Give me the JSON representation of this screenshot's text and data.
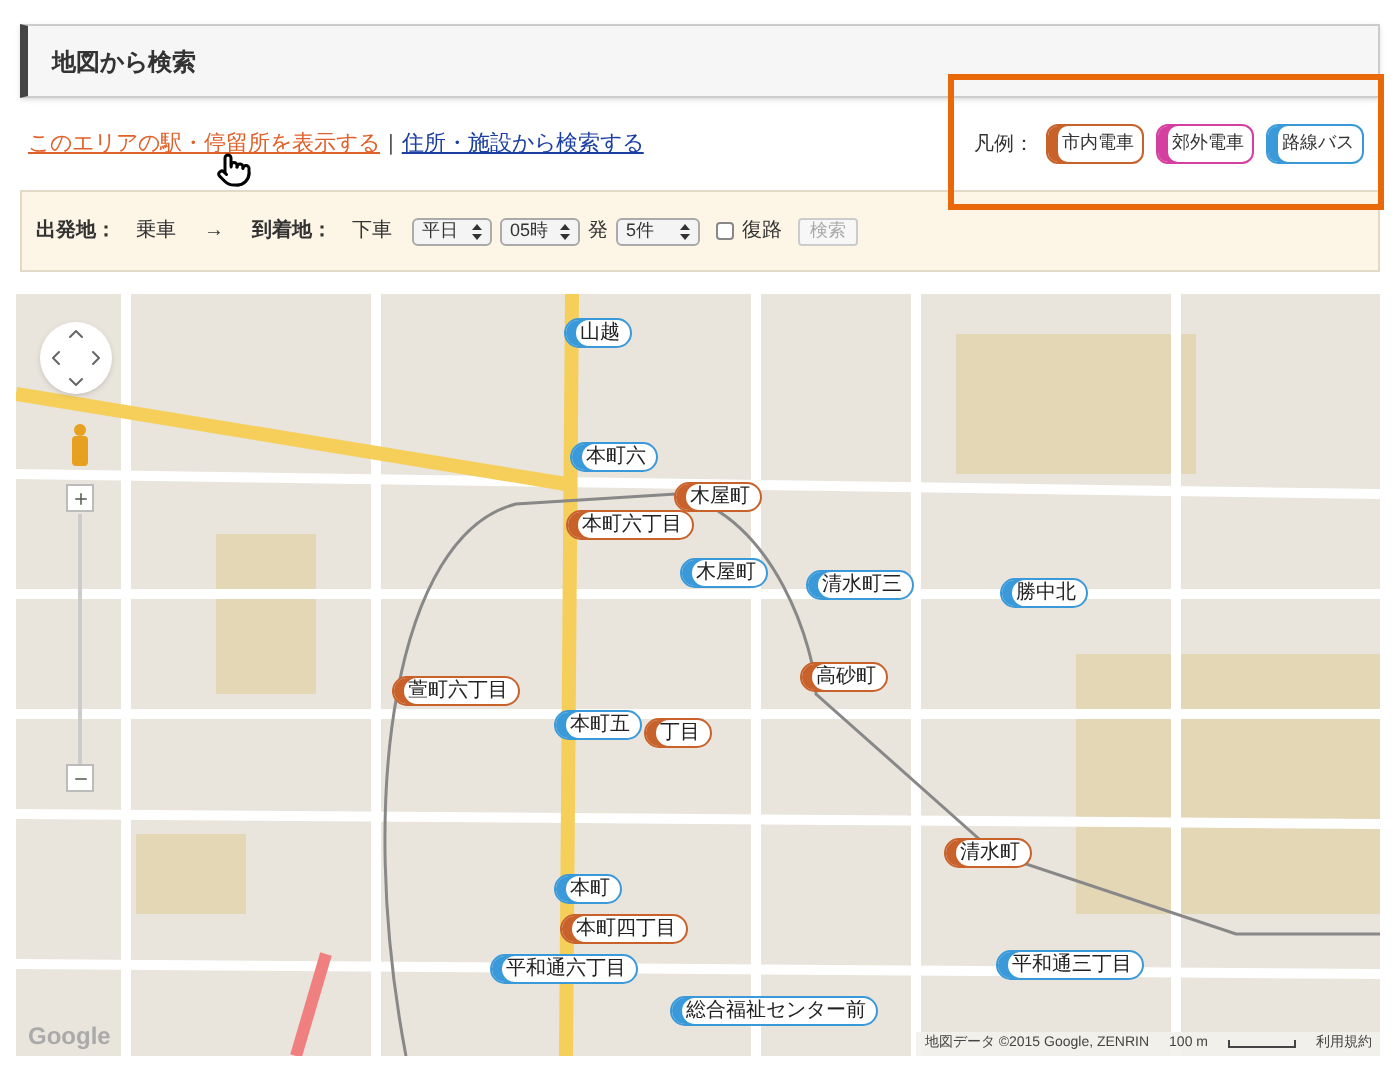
{
  "page_title": "地図から検索",
  "links": [
    {
      "text": "このエリアの駅・停留所を表示する",
      "selected": true
    },
    {
      "text": "住所・施設から検索する",
      "selected": false
    }
  ],
  "separator": "|",
  "legend": {
    "label": "凡例：",
    "items": [
      {
        "text": "市内電車",
        "color": "#c8612a"
      },
      {
        "text": "郊外電車",
        "color": "#d43fa0"
      },
      {
        "text": "路線バス",
        "color": "#3a9ad9"
      }
    ]
  },
  "search_bar": {
    "from_label": "出発地：",
    "from_value": "乗車",
    "arrow": "→",
    "to_label": "到着地：",
    "to_value": "下車",
    "day": "平日",
    "hour": "05時",
    "depart": "発",
    "count": "5件",
    "return": {
      "label": "復路",
      "checked": false
    },
    "search_button": "検索"
  },
  "map": {
    "markers": [
      {
        "kind": "bus",
        "label": "山越"
      },
      {
        "kind": "bus",
        "label": "本町六"
      },
      {
        "kind": "tram",
        "label": "木屋町"
      },
      {
        "kind": "tram",
        "label": "本町六丁目"
      },
      {
        "kind": "bus",
        "label": "木屋町"
      },
      {
        "kind": "bus",
        "label": "清水町三"
      },
      {
        "kind": "bus",
        "label": "勝中北"
      },
      {
        "kind": "tram",
        "label": "高砂町"
      },
      {
        "kind": "tram",
        "label": "萱町六丁目"
      },
      {
        "kind": "tram",
        "label": "丁目"
      },
      {
        "kind": "bus",
        "label": "本町五"
      },
      {
        "kind": "bus",
        "label": "本町"
      },
      {
        "kind": "tram",
        "label": "本町四丁目"
      },
      {
        "kind": "bus",
        "label": "平和通六丁目"
      },
      {
        "kind": "tram",
        "label": "清水町"
      },
      {
        "kind": "bus",
        "label": "平和通三丁目"
      },
      {
        "kind": "bus",
        "label": "総合福祉センター前"
      }
    ],
    "logo": "Google",
    "attribution": "地図データ ©2015 Google, ZENRIN",
    "scale": "100 m",
    "terms": "利用規約"
  }
}
